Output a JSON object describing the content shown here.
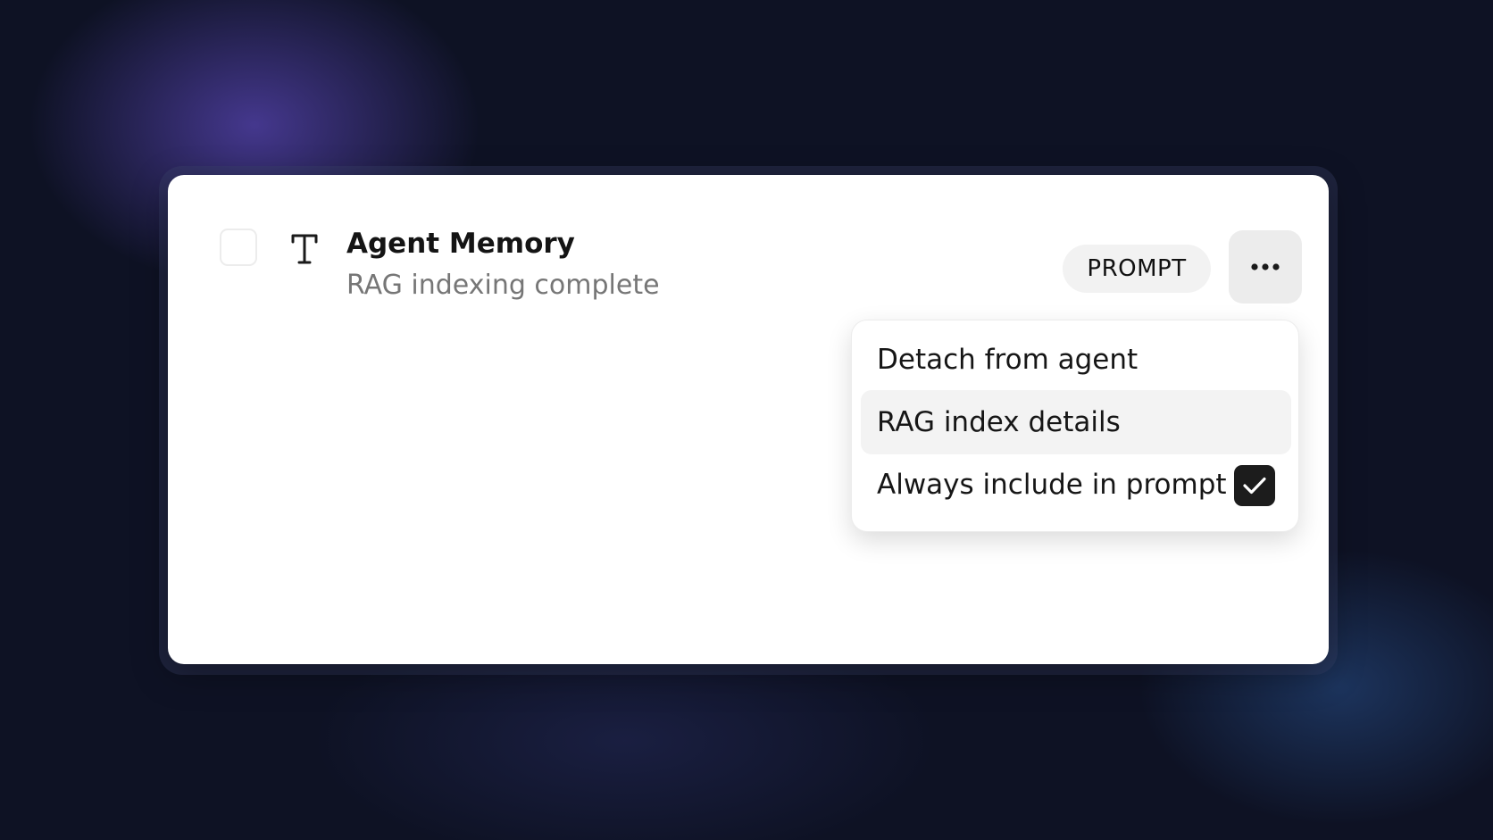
{
  "item": {
    "title": "Agent Memory",
    "subtitle": "RAG indexing complete",
    "type_icon": "text-type-icon",
    "badge": "PROMPT",
    "more_icon": "more-horizontal-icon"
  },
  "menu": {
    "items": [
      {
        "label": "Detach from agent"
      },
      {
        "label": "RAG index details"
      },
      {
        "label": "Always include in prompt",
        "checked": true
      }
    ]
  },
  "colors": {
    "background": "#0e1224",
    "card": "#ffffff",
    "checkbox_checked": "#1c1c1c"
  }
}
